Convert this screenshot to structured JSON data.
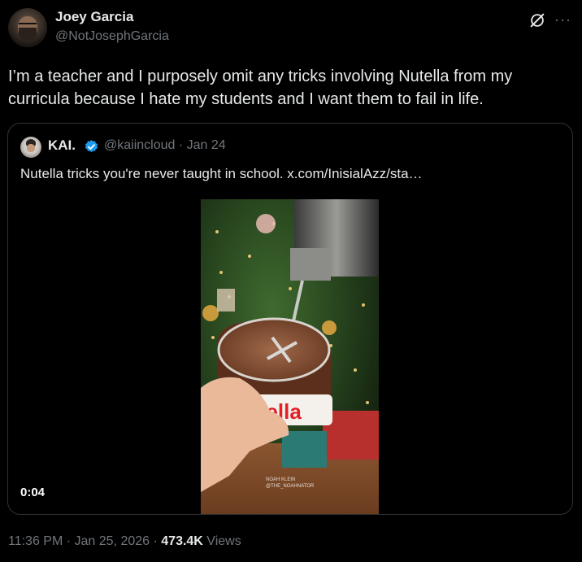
{
  "author": {
    "name": "Joey Garcia",
    "handle": "@NotJosephGarcia"
  },
  "tweet": {
    "text": "I’m a teacher and I purposely omit any tricks involving Nutella from my curricula because I hate my students and I want them to fail in life."
  },
  "quoted": {
    "name": "KAI.",
    "handle": "@kaiincloud",
    "separator": "·",
    "date": "Jan 24",
    "text": "Nutella tricks you're never taught in school.  x.com/InisialAzz/sta…",
    "video_duration": "0:04",
    "video_watermark_1": "NOAH KLEIN",
    "video_watermark_2": "@THE_NOAHNATOR",
    "video_label": "nutella"
  },
  "footer": {
    "time": "11:36 PM",
    "sep1": " · ",
    "date": "Jan 25, 2026",
    "sep2": " · ",
    "views": "473.4K",
    "views_label": " Views"
  },
  "icons": {
    "grok": "grok-icon",
    "more": "more-icon",
    "verified": "verified-icon"
  },
  "colors": {
    "background": "#000000",
    "text": "#e7e9ea",
    "secondary": "#71767b",
    "border": "#2f3336",
    "verified": "#1d9bf0"
  }
}
